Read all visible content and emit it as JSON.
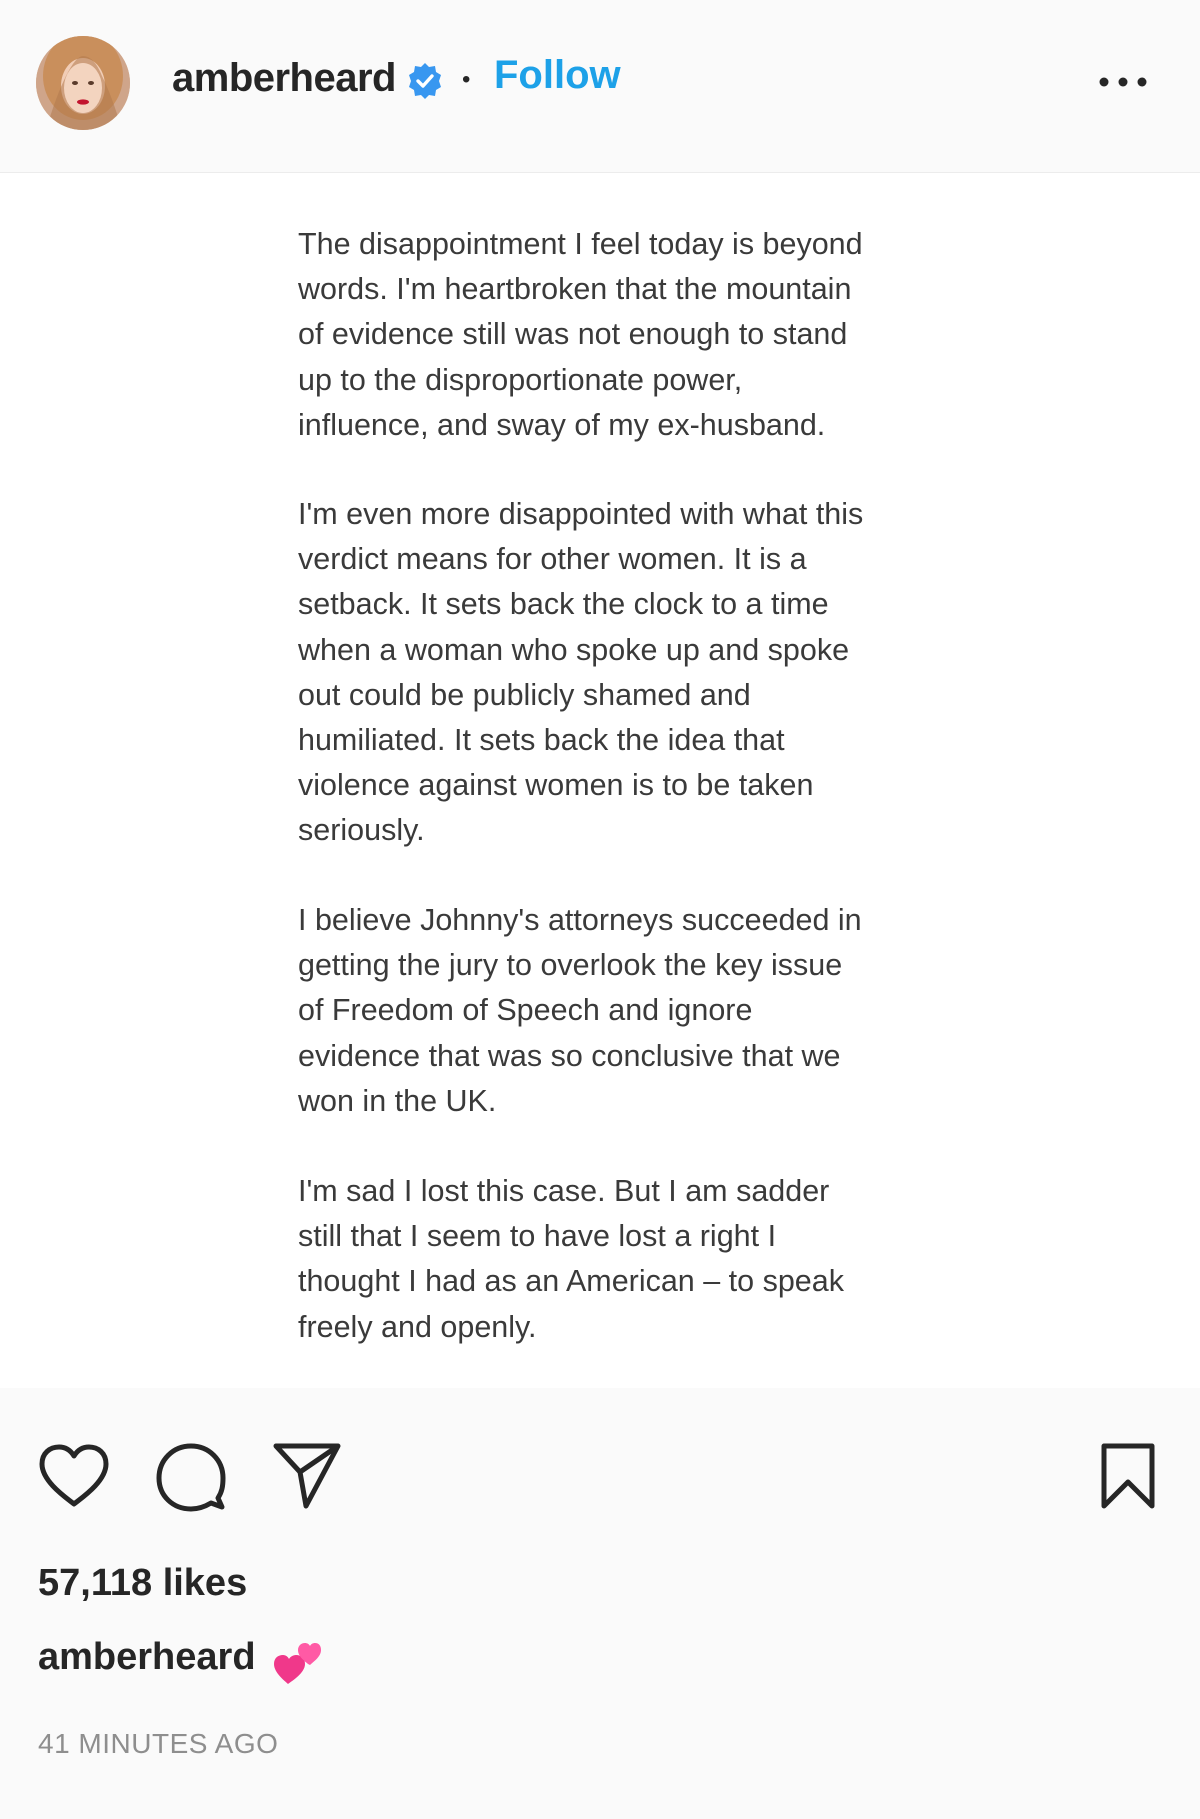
{
  "post_header": {
    "username": "amberheard",
    "separator": "•",
    "follow_label": "Follow",
    "verified_icon": "verified-badge-icon",
    "more_icon": "more-options-icon",
    "accent_color": "#1da1e8"
  },
  "post_text": {
    "paragraphs": [
      "The disappointment I feel today is beyond\nwords. I'm heartbroken that the mountain\nof evidence still was not enough to stand\nup to the disproportionate power,\ninfluence, and sway of my ex-husband.",
      "I'm even more disappointed with what this\nverdict means for other women. It is a\nsetback. It sets back the clock to a time\nwhen a woman who spoke up and spoke\nout could be publicly shamed and\nhumiliated. It sets back the idea that\nviolence against women is to be taken\nseriously.",
      "I believe Johnny's attorneys succeeded in\ngetting the jury to overlook the key issue\nof Freedom of Speech and ignore\nevidence that was so conclusive that we\nwon in the UK.",
      "I'm sad I lost this case. But I am sadder\nstill that I seem to have lost a right I\nthought I had as an American – to speak\nfreely and openly."
    ]
  },
  "actions": {
    "like_icon": "heart-icon",
    "comment_icon": "comment-icon",
    "share_icon": "share-icon",
    "save_icon": "bookmark-icon"
  },
  "likes_text": "57,118 likes",
  "caption": {
    "username": "amberheard",
    "emoji": "two-hearts-emoji"
  },
  "timestamp": "41 MINUTES AGO"
}
